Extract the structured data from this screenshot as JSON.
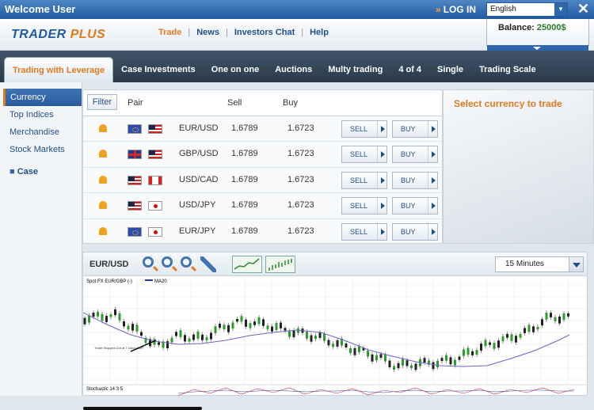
{
  "window": {
    "title": "Welcome User",
    "login_label": "LOG IN",
    "language": "English"
  },
  "header": {
    "logo_left": "TRADER",
    "logo_right": "PLUS",
    "nav": [
      "Trade",
      "News",
      "Investors Chat",
      "Help"
    ],
    "balance_label": "Balance:",
    "balance_value": "25000$"
  },
  "tabs": [
    "Trading with Leverage",
    "Case Investments",
    "One on one",
    "Auctions",
    "Multy trading",
    "4 of 4",
    "Single",
    "Trading Scale"
  ],
  "sidebar": {
    "items": [
      "Currency",
      "Top Indices",
      "Merchandise",
      "Stock Markets"
    ],
    "case": "Case"
  },
  "grid": {
    "filter_label": "Filter",
    "headers": {
      "pair": "Pair",
      "sell": "Sell",
      "buy": "Buy"
    },
    "sell_label": "SELL",
    "buy_label": "BUY",
    "rows": [
      {
        "pair": "EUR/USD",
        "sell": "1.6789",
        "buy": "1.6723"
      },
      {
        "pair": "GBP/USD",
        "sell": "1.6789",
        "buy": "1.6723"
      },
      {
        "pair": "USD/CAD",
        "sell": "1.6789",
        "buy": "1.6723"
      },
      {
        "pair": "USD/JPY",
        "sell": "1.6789",
        "buy": "1.6723"
      },
      {
        "pair": "EUR/JPY",
        "sell": "1.6789",
        "buy": "1.6723"
      }
    ]
  },
  "promo": {
    "text": "Select currency to trade"
  },
  "chart": {
    "pair": "EUR/USD",
    "timeframe": "15 Minutes",
    "plot_title": "Spot FX EUR/GBP (-)",
    "ma_label": "MA20",
    "annotation": "Trade Stopped Out at 7:15am GMT",
    "indicator_label": "Stochastic 14 3 5"
  }
}
